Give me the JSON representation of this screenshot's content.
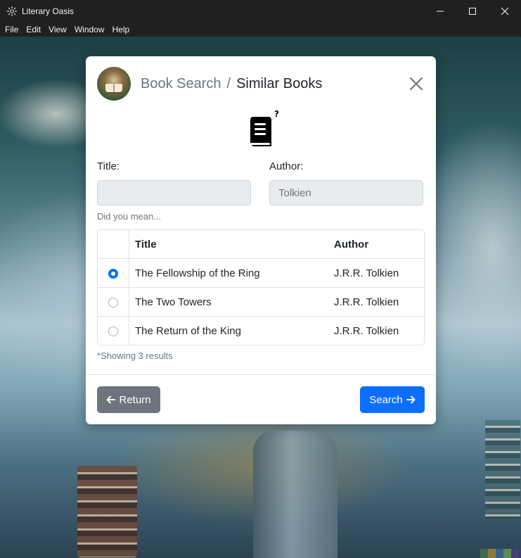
{
  "window": {
    "title": "Literary Oasis",
    "controls": [
      "minimize-icon",
      "maximize-icon",
      "close-icon"
    ]
  },
  "menu": [
    "File",
    "Edit",
    "View",
    "Window",
    "Help"
  ],
  "dialog": {
    "breadcrumb": {
      "parent": "Book Search",
      "separator": "/",
      "current": "Similar Books"
    },
    "title_label": "Title:",
    "title_value": "",
    "author_label": "Author:",
    "author_placeholder": "Tolkien",
    "hint": "Did you mean...",
    "table": {
      "headers": {
        "title": "Title",
        "author": "Author"
      },
      "rows": [
        {
          "title": "The Fellowship of the Ring",
          "author": "J.R.R. Tolkien",
          "selected": true
        },
        {
          "title": "The Two Towers",
          "author": "J.R.R. Tolkien",
          "selected": false
        },
        {
          "title": "The Return of the King",
          "author": "J.R.R. Tolkien",
          "selected": false
        }
      ]
    },
    "result_note": "*Showing 3 results",
    "return_label": "Return",
    "search_label": "Search"
  },
  "colors": {
    "primary": "#0d6efd",
    "secondary": "#6c757d",
    "titlebar": "#202020"
  }
}
